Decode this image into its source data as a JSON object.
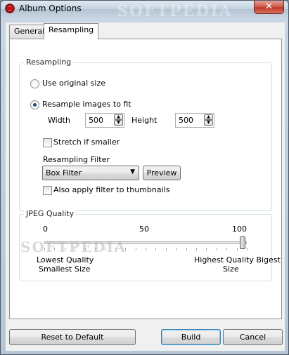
{
  "window": {
    "title": "Album Options",
    "close_glyph": "✕",
    "watermark": "SOFTPEDIA",
    "accent": "#3c7fb1"
  },
  "tabs": [
    {
      "label": "General",
      "active": false
    },
    {
      "label": "Resampling",
      "active": true
    }
  ],
  "resampling": {
    "group_label": "Resampling",
    "use_original_label": "Use original size",
    "resample_label": "Resample images to fit",
    "selected": "resample",
    "width_label": "Width",
    "width_value": "500",
    "height_label": "Height",
    "height_value": "500",
    "stretch_label": "Stretch if smaller",
    "stretch_checked": false,
    "filter_label": "Resampling Filter",
    "filter_value": "Box Filter",
    "preview_label": "Preview",
    "thumbnails_label": "Also apply filter to thumbnails",
    "thumbnails_checked": false
  },
  "jpeg": {
    "group_label": "JPEG Quality",
    "tick_0": "0",
    "tick_50": "50",
    "tick_100": "100",
    "quality_value": 98,
    "low_line1": "Lowest Quality",
    "low_line2": "Smallest Size",
    "high_line1": "Highest Quality Bigest",
    "high_line2": "Size",
    "watermark": "SOFTPEDIA"
  },
  "buttons": {
    "reset_label": "Reset to Default",
    "build_label": "Build",
    "cancel_label": "Cancel"
  }
}
